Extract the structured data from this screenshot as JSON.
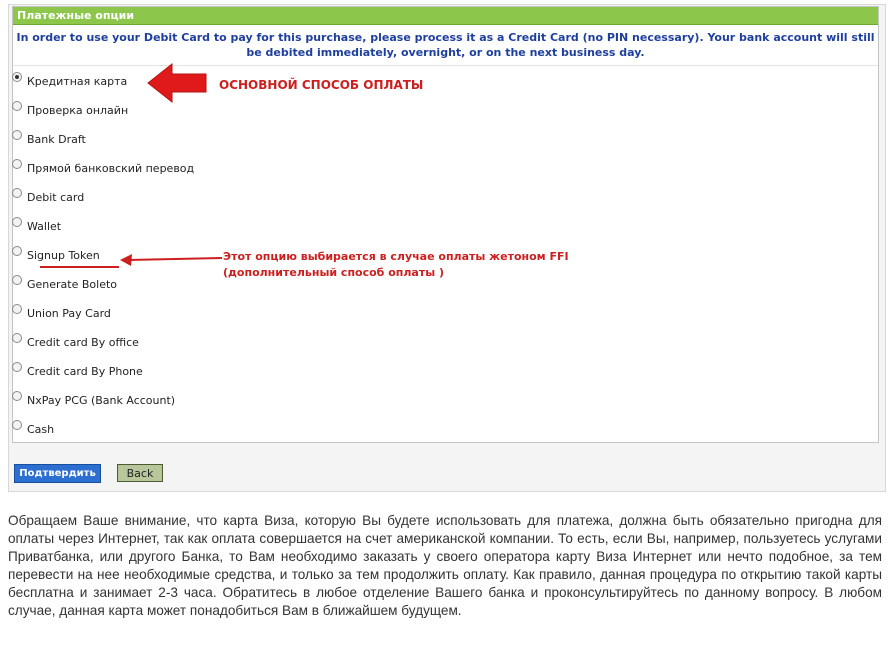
{
  "panel": {
    "header": "Платежные опции",
    "notice": "In order to use your Debit Card to pay for this purchase, please process it as a Credit Card (no PIN necessary). Your bank account will still be debited immediately, overnight, or on the next business day."
  },
  "options": [
    {
      "label": "Кредитная карта",
      "checked": true
    },
    {
      "label": "Проверка онлайн",
      "checked": false
    },
    {
      "label": "Bank Draft",
      "checked": false
    },
    {
      "label": "Прямой банковский перевод",
      "checked": false
    },
    {
      "label": "Debit card",
      "checked": false
    },
    {
      "label": "Wallet",
      "checked": false
    },
    {
      "label": "Signup Token",
      "checked": false
    },
    {
      "label": "Generate Boleto",
      "checked": false
    },
    {
      "label": "Union Pay Card",
      "checked": false
    },
    {
      "label": "Credit card By office",
      "checked": false
    },
    {
      "label": "Credit card By Phone",
      "checked": false
    },
    {
      "label": "NxPay PCG (Bank Account)",
      "checked": false
    },
    {
      "label": "Cash",
      "checked": false
    }
  ],
  "annotations": {
    "main_method": "ОСНОВНОЙ СПОСОБ ОПЛАТЫ",
    "token_line1": "Этот опцию выбирается в случае оплаты жетоном FFI",
    "token_line2": "(дополнительный способ оплаты )",
    "color": "#cc1f1f"
  },
  "buttons": {
    "confirm": "Подтвердить",
    "back": "Back"
  },
  "body_text": "Обращаем Ваше внимание, что карта Виза, которую Вы будете использовать для платежа, должна быть обязательно пригодна для оплаты через Интернет, так как оплата совершается на счет американской компании. То есть, если Вы, например, пользуетесь услугами Приватбанка, или другого Банка, то Вам необходимо заказать у своего оператора карту Виза Интернет или нечто подобное, за тем перевести на нее необходимые средства, и только за тем продолжить оплату. Как правило, данная процедура по открытию такой карты бесплатна и занимает 2-3 часа. Обратитесь в любое отделение Вашего банка и проконсультируйтесь по данному вопросу. В любом случае, данная карта может понадобиться Вам в ближайшем будущем."
}
